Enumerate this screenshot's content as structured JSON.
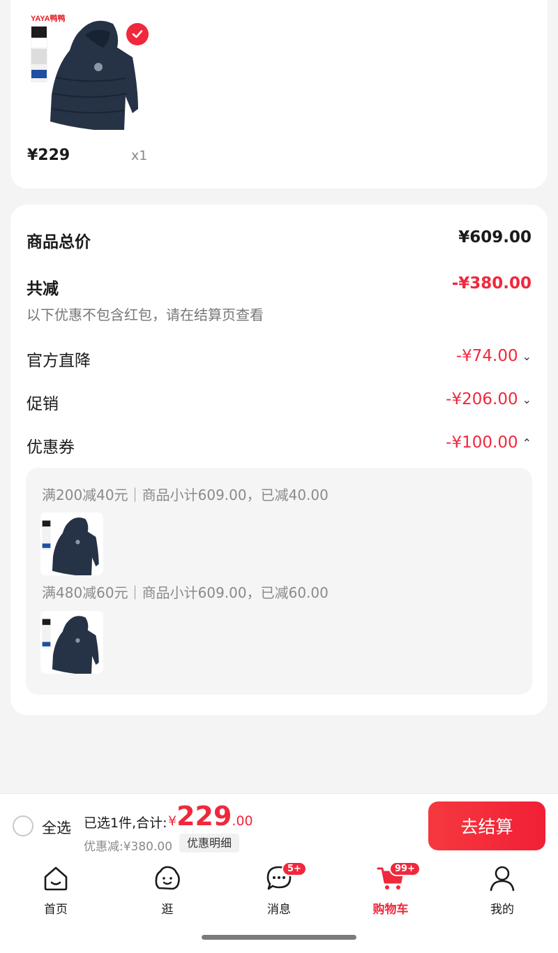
{
  "product": {
    "price": "¥229",
    "quantity": "x1",
    "brand_text": "YAYA鸭鸭"
  },
  "summary": {
    "total_label": "商品总价",
    "total_value": "¥609.00",
    "reduce_label": "共减",
    "reduce_value": "-¥380.00",
    "reduce_note": "以下优惠不包含红包，请在结算页查看",
    "rows": [
      {
        "label": "官方直降",
        "value": "-¥74.00",
        "chevron": "chevron-down-icon"
      },
      {
        "label": "促销",
        "value": "-¥206.00",
        "chevron": "chevron-down-icon"
      },
      {
        "label": "优惠券",
        "value": "-¥100.00",
        "chevron": "chevron-up-icon"
      }
    ],
    "coupons": [
      {
        "text": "满200减40元｜商品小计609.00，已减40.00"
      },
      {
        "text": "满480减60元｜商品小计609.00，已减60.00"
      }
    ]
  },
  "checkout": {
    "select_all": "全选",
    "selected_text": "已选1件,合计:",
    "currency": "¥",
    "total_int": "229",
    "total_dec": ".00",
    "discount_text": "优惠减:¥380.00",
    "detail_button": "优惠明细",
    "pay_button": "去结算"
  },
  "tabs": [
    {
      "label": "首页",
      "icon": "home-icon"
    },
    {
      "label": "逛",
      "icon": "browse-icon"
    },
    {
      "label": "消息",
      "icon": "message-icon",
      "badge": "5+"
    },
    {
      "label": "购物车",
      "icon": "cart-icon",
      "badge": "99+",
      "active": true
    },
    {
      "label": "我的",
      "icon": "profile-icon"
    }
  ],
  "colors": {
    "accent": "#f0283c",
    "background": "#f4f4f4",
    "card": "#ffffff"
  }
}
